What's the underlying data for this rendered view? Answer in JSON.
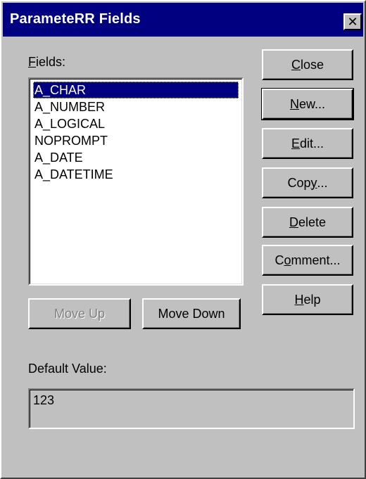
{
  "window": {
    "title": "ParameteRR Fields",
    "close_glyph": "✕"
  },
  "fields_label": {
    "accel": "F",
    "rest": "ields:"
  },
  "fields": [
    {
      "name": "A_CHAR",
      "selected": true
    },
    {
      "name": "A_NUMBER",
      "selected": false
    },
    {
      "name": "A_LOGICAL",
      "selected": false
    },
    {
      "name": "NOPROMPT",
      "selected": false
    },
    {
      "name": "A_DATE",
      "selected": false
    },
    {
      "name": "A_DATETIME",
      "selected": false
    }
  ],
  "buttons": {
    "close": {
      "accel": "C",
      "rest": "lose"
    },
    "new": {
      "accel": "N",
      "rest": "ew..."
    },
    "edit": {
      "accel": "E",
      "rest": "dit..."
    },
    "copy": {
      "pre": "Cop",
      "accel": "y",
      "rest": "..."
    },
    "delete": {
      "accel": "D",
      "rest": "elete"
    },
    "comment": {
      "pre": "C",
      "accel": "o",
      "rest": "mment..."
    },
    "help": {
      "accel": "H",
      "rest": "elp"
    },
    "move_up": "Move Up",
    "move_down": "Move Down"
  },
  "default_value": {
    "label": "Default Value:",
    "value": "123"
  },
  "colors": {
    "face": "#c0c0c0",
    "titlebar": "#000080",
    "selection": "#000080"
  }
}
